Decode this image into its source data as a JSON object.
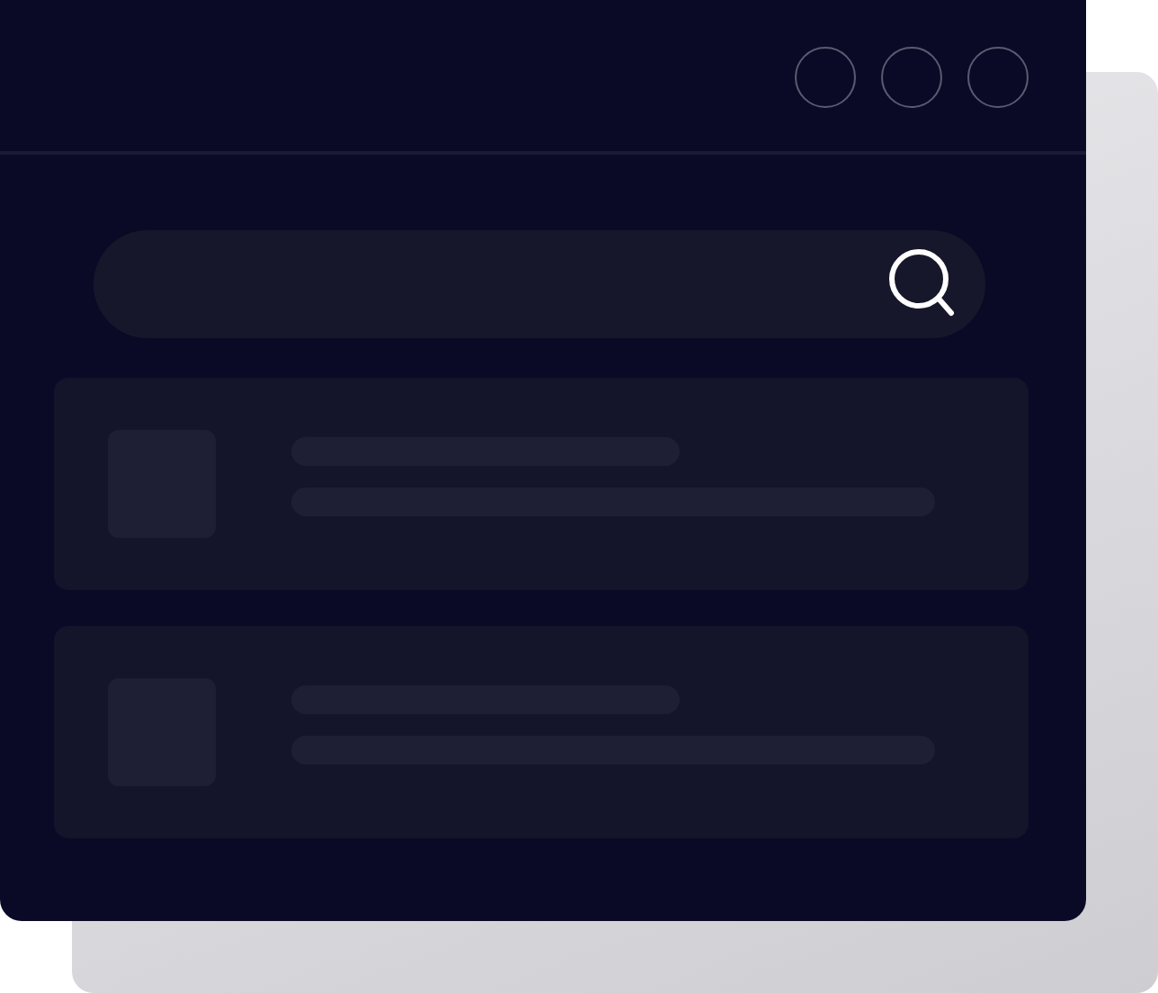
{
  "window": {
    "controls": [
      {
        "kind": "circle"
      },
      {
        "kind": "circle"
      },
      {
        "kind": "circle"
      }
    ]
  },
  "search": {
    "kind": "field"
  },
  "results": [
    {
      "kind": "skeleton"
    },
    {
      "kind": "skeleton"
    }
  ]
}
